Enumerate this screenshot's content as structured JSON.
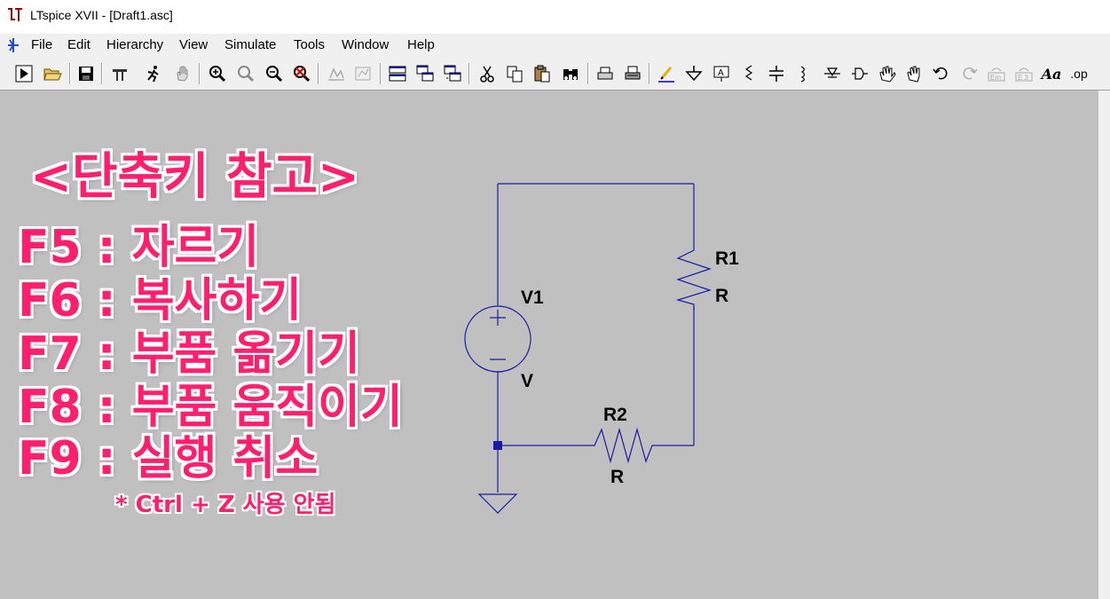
{
  "window": {
    "title": "LTspice XVII - [Draft1.asc]"
  },
  "menu": {
    "items": [
      "File",
      "Edit",
      "Hierarchy",
      "View",
      "Simulate",
      "Tools",
      "Window",
      "Help"
    ]
  },
  "toolbar": {
    "buttons": [
      "run-icon",
      "open-icon",
      "save-icon",
      "control-panel-icon",
      "halt-icon",
      "pan-icon",
      "zoom-in-icon",
      "zoom-area-icon",
      "zoom-out-icon",
      "zoom-fit-icon",
      "autorange-icon",
      "trace-icon",
      "tile-horizontal-icon",
      "cascade-icon",
      "tile-vertical-icon",
      "cut-icon",
      "copy-icon",
      "paste-icon",
      "find-icon",
      "print-preview-icon",
      "print-icon",
      "wire-icon",
      "ground-icon",
      "label-icon",
      "resistor-icon",
      "capacitor-icon",
      "inductor-icon",
      "diode-icon",
      "component-icon",
      "move-icon",
      "drag-icon",
      "undo-icon",
      "redo-icon",
      "rotate-icon",
      "mirror-icon",
      "text-icon",
      "spice-directive-icon"
    ],
    "text_aa": "Aa",
    "text_op": ".op"
  },
  "overlay": {
    "heading": "<단축키 참고>",
    "shortcuts": [
      "F5 : 자르기",
      "F6 : 복사하기",
      "F7 : 부품 옮기기",
      "F8 : 부품 움직이기",
      "F9 : 실행 취소"
    ],
    "note": "* Ctrl + Z 사용 안됨",
    "accent_color": "#ff1f6c"
  },
  "schematic": {
    "wire_color": "#1a1aa8",
    "v1": {
      "name": "V1",
      "value": "V"
    },
    "r1": {
      "name": "R1",
      "value": "R"
    },
    "r2": {
      "name": "R2",
      "value": "R"
    }
  }
}
